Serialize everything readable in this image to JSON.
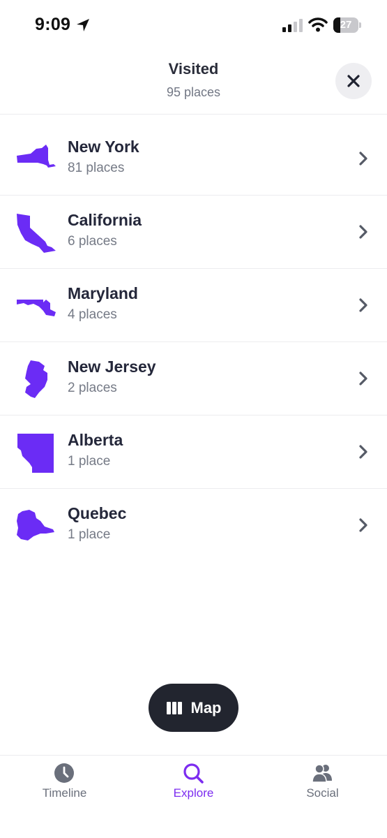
{
  "status_bar": {
    "time": "9:09",
    "battery": "27",
    "battery_level_percent": 27
  },
  "header": {
    "title": "Visited",
    "subtitle": "95 places"
  },
  "colors": {
    "accent": "#7c2cf0",
    "shape_fill": "#6b2cf5",
    "dark_button": "#22252f"
  },
  "places": [
    {
      "name": "New York",
      "count": "81 places",
      "icon": "new-york-shape"
    },
    {
      "name": "California",
      "count": "6 places",
      "icon": "california-shape"
    },
    {
      "name": "Maryland",
      "count": "4 places",
      "icon": "maryland-shape"
    },
    {
      "name": "New Jersey",
      "count": "2 places",
      "icon": "new-jersey-shape"
    },
    {
      "name": "Alberta",
      "count": "1 place",
      "icon": "alberta-shape"
    },
    {
      "name": "Quebec",
      "count": "1 place",
      "icon": "quebec-shape"
    }
  ],
  "map_button": {
    "label": "Map",
    "icon": "map-icon"
  },
  "tabs": [
    {
      "label": "Timeline",
      "icon": "clock-icon",
      "active": false
    },
    {
      "label": "Explore",
      "icon": "search-icon",
      "active": true
    },
    {
      "label": "Social",
      "icon": "people-icon",
      "active": false
    }
  ]
}
